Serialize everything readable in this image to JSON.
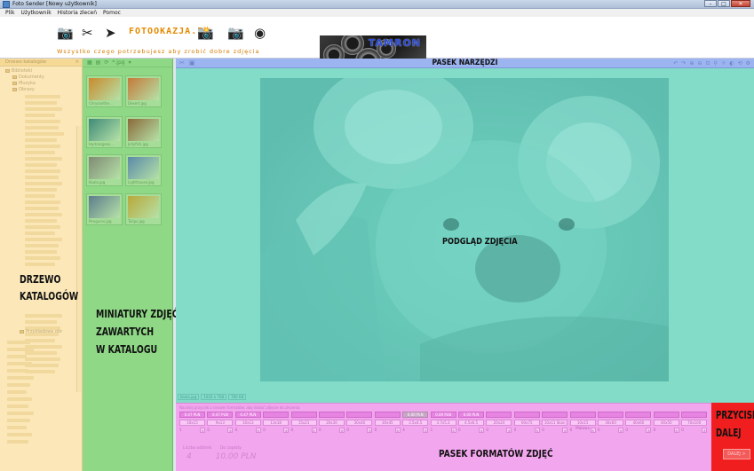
{
  "window": {
    "title": "Foto Sender [Nowy użytkownik]"
  },
  "menu": [
    "Plik",
    "Użytkownik",
    "Historia zleceń",
    "Pomoc"
  ],
  "banner": {
    "brand": "FOTOOKAZJA.PL",
    "tagline": "Wszystko czego potrzebujesz aby zrobić dobre zdjęcia",
    "ad_text": "TAMRON"
  },
  "tree": {
    "header": "Drzewo katalogów",
    "nodes": [
      "Biblioteki",
      "Dokumenty",
      "Muzyka",
      "Obrazy",
      "Przykładowe obr"
    ],
    "label_lines": [
      "DRZEWO",
      "KATALOGÓW"
    ]
  },
  "thumbnails": {
    "filter": "*.jpg",
    "items": [
      {
        "caption": "Chrysanthe...",
        "color": "#c98a2e"
      },
      {
        "caption": "Desert.jpg",
        "color": "#c47a3a"
      },
      {
        "caption": "Hydrangeas...",
        "color": "#3f8a78"
      },
      {
        "caption": "Jellyfish.jpg",
        "color": "#8a6a3a"
      },
      {
        "caption": "Koala.jpg",
        "color": "#7f8a74"
      },
      {
        "caption": "Lighthouse.jpg",
        "color": "#5b8aa8"
      },
      {
        "caption": "Penguins.jpg",
        "color": "#5d7d8c"
      },
      {
        "caption": "Tulips.jpg",
        "color": "#b8a83a"
      }
    ],
    "label_lines": [
      "MINIATURY ZDJĘĆ",
      "ZAWARTYCH",
      "W KATALOGU"
    ]
  },
  "toolbar": {
    "label": "PASEK NARZĘDZI"
  },
  "preview": {
    "label": "PODGLĄD ZDJĘCIA",
    "info": [
      "Koala.jpg",
      "1024 x 768",
      "760 KB"
    ]
  },
  "formats": {
    "instruction": "Naciśnij przycisk z cenami formatów, aby dodać zdjęcie do zlecenia",
    "items": [
      {
        "price": "0.47 PLN",
        "size": "10x15",
        "qty": "1",
        "active": true
      },
      {
        "price": "0.47 PLN",
        "size": "9x13",
        "qty": "0",
        "active": true
      },
      {
        "price": "0.47 PLN",
        "size": "10x13",
        "qty": "0",
        "active": true
      },
      {
        "price": "",
        "size": "13x18",
        "qty": "0",
        "active": true
      },
      {
        "price": "",
        "size": "15x21",
        "qty": "0",
        "active": true
      },
      {
        "price": "",
        "size": "20x30",
        "qty": "0",
        "active": true
      },
      {
        "price": "",
        "size": "30x40",
        "qty": "0",
        "active": true
      },
      {
        "price": "",
        "size": "30x45",
        "qty": "0",
        "active": true
      },
      {
        "price": "0.00 PLN",
        "size": "3.5x4.5",
        "qty": "4",
        "active": false
      },
      {
        "price": "0.00 PLN",
        "size": "3.7x5.2",
        "qty": "1",
        "active": true
      },
      {
        "price": "0.00 PLN",
        "size": "4.5x6.5",
        "qty": "0",
        "active": true
      },
      {
        "price": "",
        "size": "20x24",
        "qty": "0",
        "active": true
      },
      {
        "price": "",
        "size": "60x75",
        "qty": "0",
        "active": true
      },
      {
        "price": "",
        "size": "10x11 Skan",
        "qty": "0",
        "active": true
      },
      {
        "price": "",
        "size": "10x15 Matowe",
        "qty": "0",
        "active": true
      },
      {
        "price": "",
        "size": "30x60",
        "qty": "0",
        "active": true
      },
      {
        "price": "",
        "size": "40x60",
        "qty": "0",
        "active": true
      },
      {
        "price": "",
        "size": "40x50",
        "qty": "0",
        "active": true
      },
      {
        "price": "",
        "size": "70x100",
        "qty": "0",
        "active": true
      }
    ],
    "totals": {
      "photos_label": "Liczba odbitek",
      "photos_value": "4",
      "pay_label": "Do zapłaty",
      "pay_value": "10.00 PLN"
    },
    "label": "PASEK FORMATÓW ZDJĘĆ"
  },
  "next": {
    "label_lines": [
      "PRZYCISK",
      "DALEJ"
    ],
    "button": "DALEJ >"
  },
  "colors": {
    "tree_panel": "#fbe7b8",
    "thumb_panel": "#8ed886",
    "toolbar": "#9cb4f0",
    "preview": "#82dcc8",
    "formats": "#f2a6ee",
    "next": "#f01e1e"
  }
}
